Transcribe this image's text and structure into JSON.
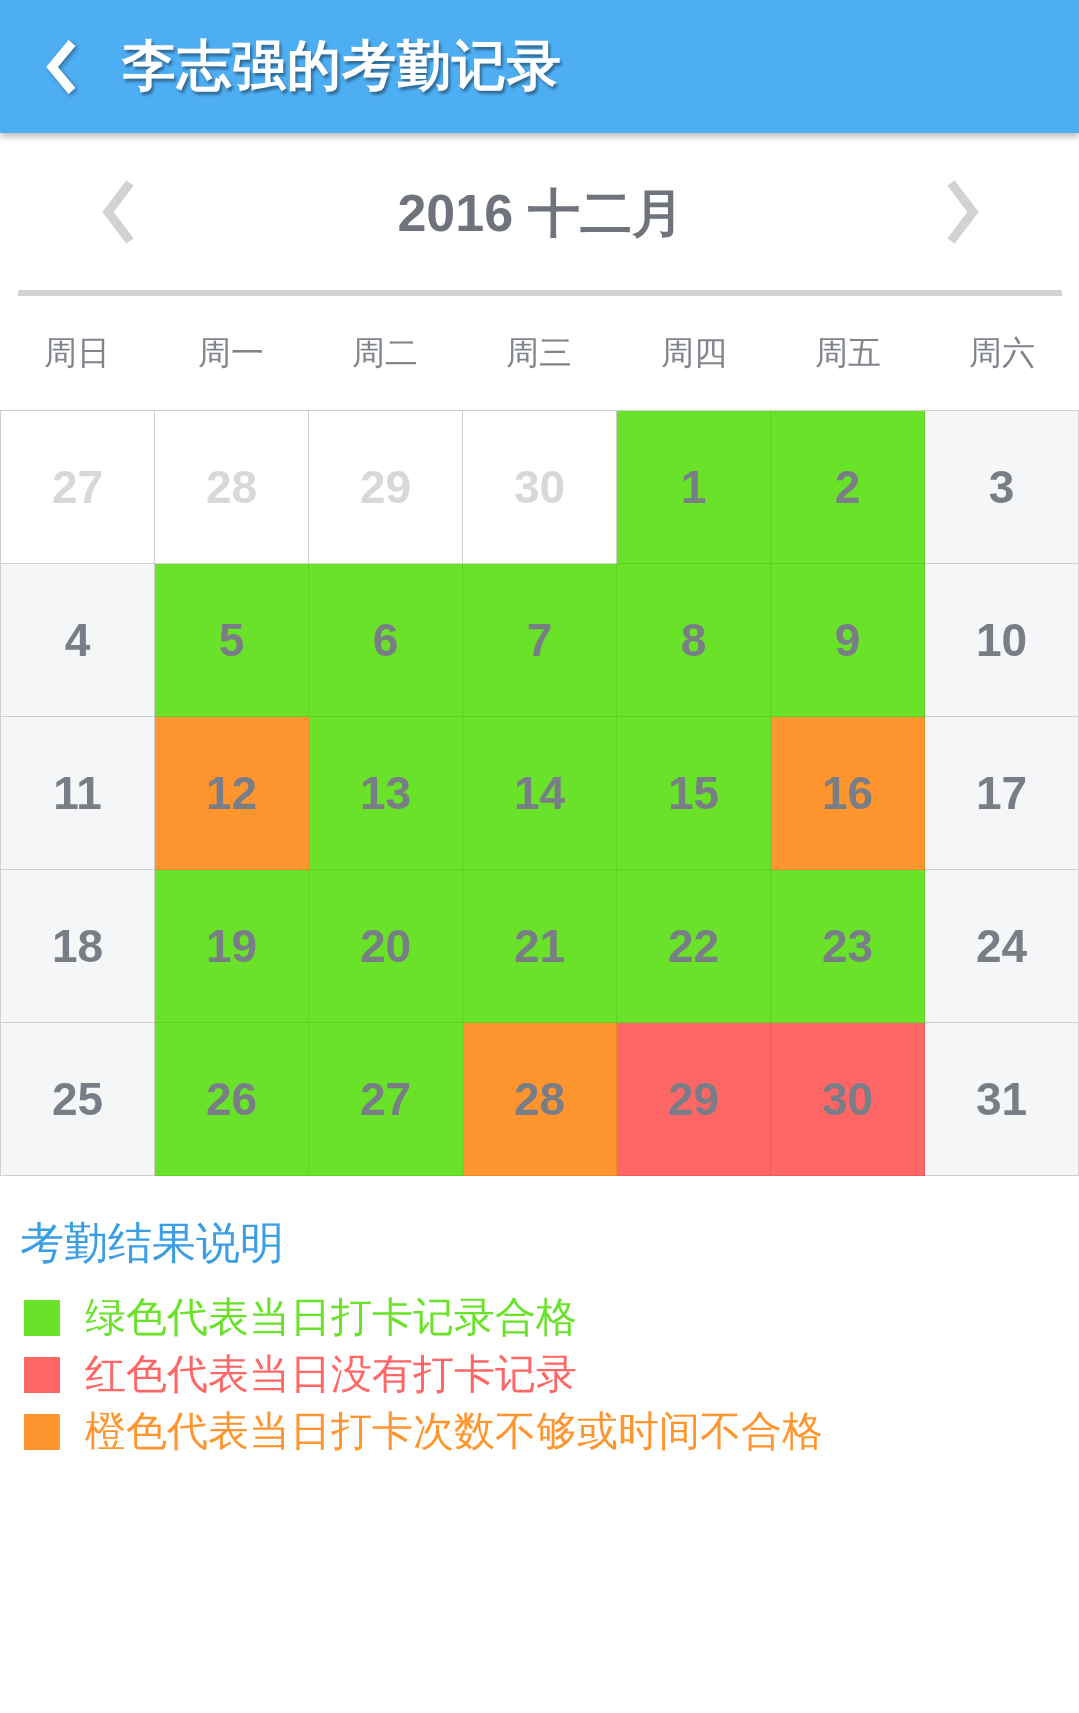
{
  "app_bar": {
    "title": "李志强的考勤记录"
  },
  "month_nav": {
    "title": "2016 十二月"
  },
  "weekdays": [
    "周日",
    "周一",
    "周二",
    "周三",
    "周四",
    "周五",
    "周六"
  ],
  "calendar": {
    "weeks": [
      {
        "days": [
          {
            "day": "27",
            "kind": "outside"
          },
          {
            "day": "28",
            "kind": "outside"
          },
          {
            "day": "29",
            "kind": "outside"
          },
          {
            "day": "30",
            "kind": "outside"
          },
          {
            "day": "1",
            "kind": "workday",
            "color": "#6ae22a"
          },
          {
            "day": "2",
            "kind": "workday",
            "color": "#6ae22a"
          },
          {
            "day": "3",
            "kind": "weekend"
          }
        ]
      },
      {
        "days": [
          {
            "day": "4",
            "kind": "weekend"
          },
          {
            "day": "5",
            "kind": "workday",
            "color": "#6ae22a"
          },
          {
            "day": "6",
            "kind": "workday",
            "color": "#6ae22a"
          },
          {
            "day": "7",
            "kind": "workday",
            "color": "#6ae22a"
          },
          {
            "day": "8",
            "kind": "workday",
            "color": "#6ae22a"
          },
          {
            "day": "9",
            "kind": "workday",
            "color": "#6ae22a"
          },
          {
            "day": "10",
            "kind": "weekend"
          }
        ]
      },
      {
        "days": [
          {
            "day": "11",
            "kind": "weekend"
          },
          {
            "day": "12",
            "kind": "workday",
            "color": "#ff952e"
          },
          {
            "day": "13",
            "kind": "workday",
            "color": "#6ae22a"
          },
          {
            "day": "14",
            "kind": "workday",
            "color": "#6ae22a"
          },
          {
            "day": "15",
            "kind": "workday",
            "color": "#6ae22a"
          },
          {
            "day": "16",
            "kind": "workday",
            "color": "#ff952e"
          },
          {
            "day": "17",
            "kind": "weekend"
          }
        ]
      },
      {
        "days": [
          {
            "day": "18",
            "kind": "weekend"
          },
          {
            "day": "19",
            "kind": "workday",
            "color": "#6ae22a"
          },
          {
            "day": "20",
            "kind": "workday",
            "color": "#6ae22a"
          },
          {
            "day": "21",
            "kind": "workday",
            "color": "#6ae22a"
          },
          {
            "day": "22",
            "kind": "workday",
            "color": "#6ae22a"
          },
          {
            "day": "23",
            "kind": "workday",
            "color": "#6ae22a"
          },
          {
            "day": "24",
            "kind": "weekend"
          }
        ]
      },
      {
        "days": [
          {
            "day": "25",
            "kind": "weekend"
          },
          {
            "day": "26",
            "kind": "workday",
            "color": "#6ae22a"
          },
          {
            "day": "27",
            "kind": "workday",
            "color": "#6ae22a"
          },
          {
            "day": "28",
            "kind": "workday",
            "color": "#ff952e"
          },
          {
            "day": "29",
            "kind": "workday",
            "color": "#ff6666"
          },
          {
            "day": "30",
            "kind": "workday",
            "color": "#ff6666"
          },
          {
            "day": "31",
            "kind": "weekend"
          }
        ]
      }
    ]
  },
  "legend": {
    "title": "考勤结果说明",
    "items": [
      {
        "text": "绿色代表当日打卡记录合格",
        "color": "#6ae22a"
      },
      {
        "text": "红色代表当日没有打卡记录",
        "color": "#ff6666"
      },
      {
        "text": "橙色代表当日打卡次数不够或时间不合格",
        "color": "#ff952e"
      }
    ]
  }
}
